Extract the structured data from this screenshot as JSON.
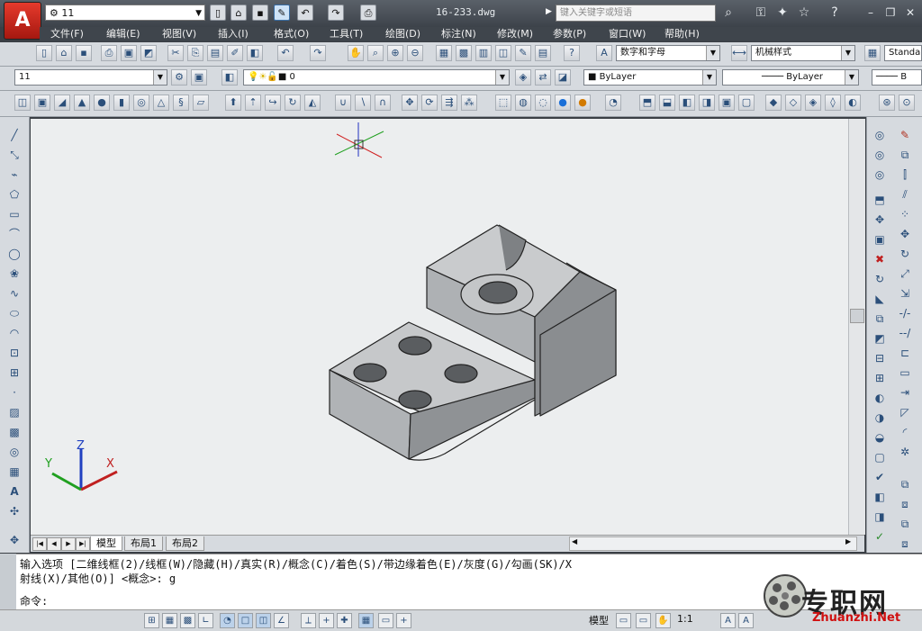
{
  "title_bar": {
    "app_button": "A",
    "workspace": "11",
    "document_title": "16-233.dwg",
    "search_placeholder": "键入关键字或短语"
  },
  "menu": [
    "文件(F)",
    "编辑(E)",
    "视图(V)",
    "插入(I)",
    "格式(O)",
    "工具(T)",
    "绘图(D)",
    "标注(N)",
    "修改(M)",
    "参数(P)",
    "窗口(W)",
    "帮助(H)"
  ],
  "toolbar2": {
    "text_style": "数字和字母",
    "dim_style": "机械样式",
    "table_style": "Standa"
  },
  "toolbar3": {
    "layer_state": "11",
    "layer_name": "0",
    "color": "ByLayer",
    "linetype": "ByLayer",
    "lineweight_prefix": "B"
  },
  "layout_tabs": {
    "model": "模型",
    "layout1": "布局1",
    "layout2": "布局2"
  },
  "ucs": {
    "x": "X",
    "y": "Y",
    "z": "Z"
  },
  "command": {
    "line1": "输入选项 [二维线框(2)/线框(W)/隐藏(H)/真实(R)/概念(C)/着色(S)/带边缘着色(E)/灰度(G)/勾画(SK)/X",
    "line2": "射线(X)/其他(O)] <概念>: g",
    "prompt": "命令:"
  },
  "status": {
    "model": "模型",
    "scale": "1:1"
  },
  "watermark": {
    "text": "专职网",
    "url": "Zhuanzhi.Net"
  }
}
